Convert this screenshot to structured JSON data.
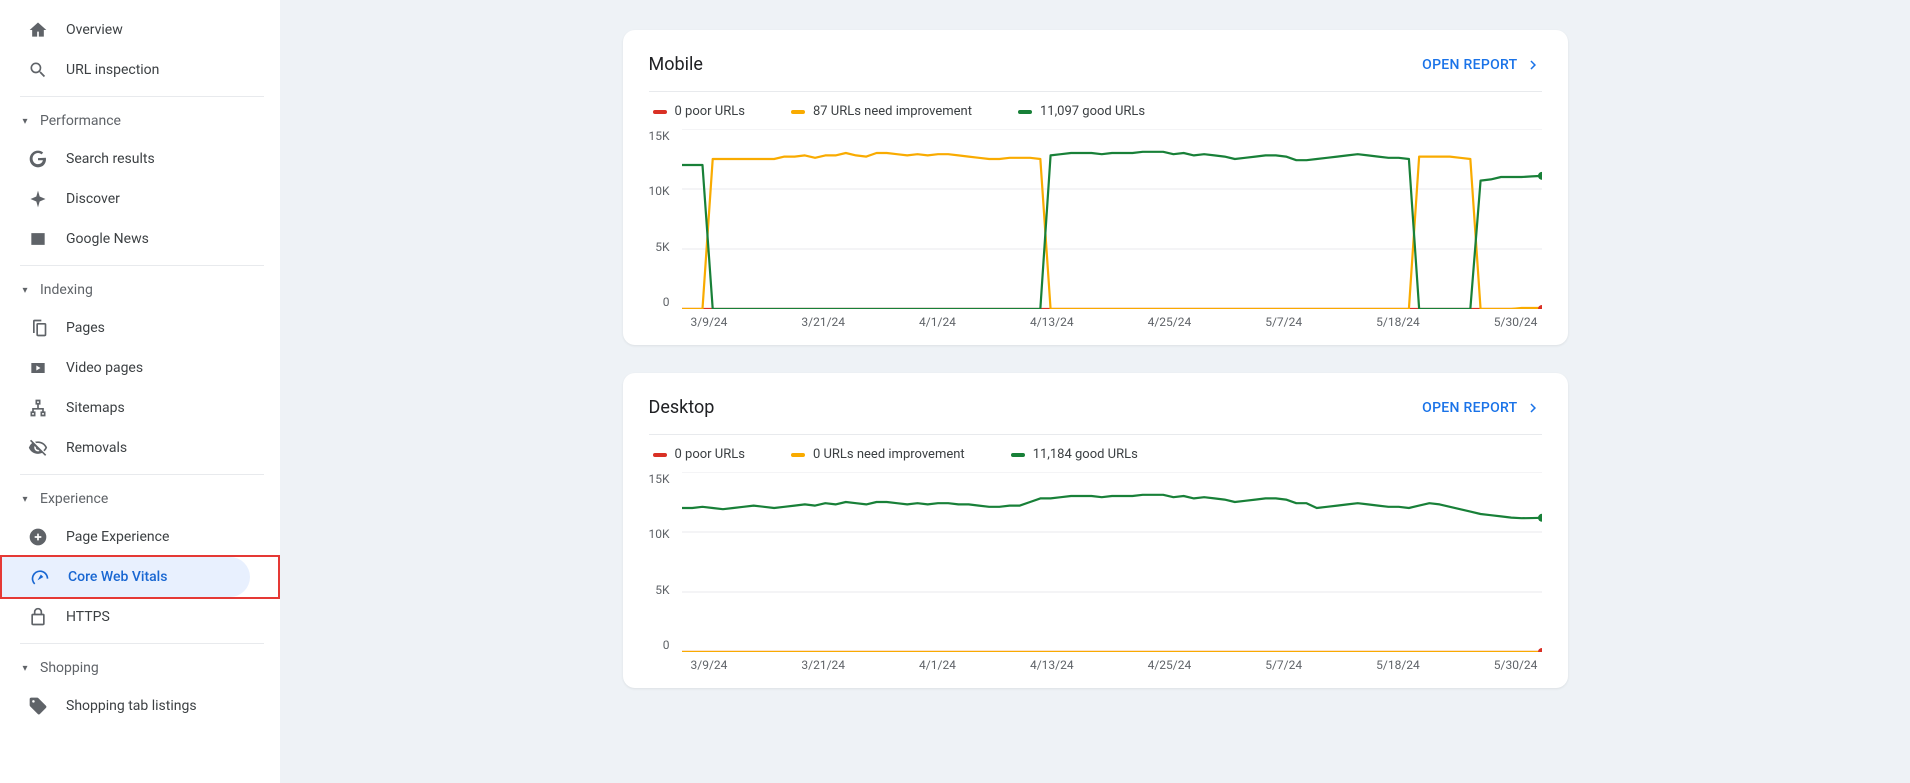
{
  "sidebar": {
    "overview": "Overview",
    "url_inspection": "URL inspection",
    "performance_hdr": "Performance",
    "search_results": "Search results",
    "discover": "Discover",
    "google_news": "Google News",
    "indexing_hdr": "Indexing",
    "pages": "Pages",
    "video_pages": "Video pages",
    "sitemaps": "Sitemaps",
    "removals": "Removals",
    "experience_hdr": "Experience",
    "page_experience": "Page Experience",
    "core_web_vitals": "Core Web Vitals",
    "https": "HTTPS",
    "shopping_hdr": "Shopping",
    "shopping_tab": "Shopping tab listings"
  },
  "common": {
    "open_report": "OPEN REPORT"
  },
  "mobile": {
    "title": "Mobile",
    "legend_poor": "0 poor URLs",
    "legend_need": "87 URLs need improvement",
    "legend_good": "11,097 good URLs"
  },
  "desktop": {
    "title": "Desktop",
    "legend_poor": "0 poor URLs",
    "legend_need": "0 URLs need improvement",
    "legend_good": "11,184 good URLs"
  },
  "axes": {
    "y": [
      "15K",
      "10K",
      "5K",
      "0"
    ],
    "x": [
      "3/9/24",
      "3/21/24",
      "4/1/24",
      "4/13/24",
      "4/25/24",
      "5/7/24",
      "5/18/24",
      "5/30/24"
    ]
  },
  "chart_data": [
    {
      "type": "line",
      "name": "mobile",
      "title": "Mobile",
      "ylim": [
        0,
        15000
      ],
      "yticks": [
        0,
        5000,
        10000,
        15000
      ],
      "xlabels": [
        "3/9/24",
        "3/21/24",
        "4/1/24",
        "4/13/24",
        "4/25/24",
        "5/7/24",
        "5/18/24",
        "5/30/24"
      ],
      "x": [
        0,
        1,
        2,
        3,
        4,
        5,
        6,
        7,
        8,
        9,
        10,
        11,
        12,
        13,
        14,
        15,
        16,
        17,
        18,
        19,
        20,
        21,
        22,
        23,
        24,
        25,
        26,
        27,
        28,
        29,
        30,
        31,
        32,
        33,
        34,
        35,
        36,
        37,
        38,
        39,
        40,
        41,
        42,
        43,
        44,
        45,
        46,
        47,
        48,
        49,
        50,
        51,
        52,
        53,
        54,
        55,
        56,
        57,
        58,
        59,
        60,
        61,
        62,
        63,
        64,
        65,
        66,
        67,
        68,
        69,
        70,
        71,
        72,
        73,
        74,
        75,
        76,
        77,
        78,
        79,
        80,
        81,
        82,
        83,
        84
      ],
      "series": [
        {
          "name": "poor",
          "color": "#d93025",
          "values": [
            0,
            0,
            0,
            0,
            0,
            0,
            0,
            0,
            0,
            0,
            0,
            0,
            0,
            0,
            0,
            0,
            0,
            0,
            0,
            0,
            0,
            0,
            0,
            0,
            0,
            0,
            0,
            0,
            0,
            0,
            0,
            0,
            0,
            0,
            0,
            0,
            0,
            0,
            0,
            0,
            0,
            0,
            0,
            0,
            0,
            0,
            0,
            0,
            0,
            0,
            0,
            0,
            0,
            0,
            0,
            0,
            0,
            0,
            0,
            0,
            0,
            0,
            0,
            0,
            0,
            0,
            0,
            0,
            0,
            0,
            0,
            0,
            0,
            0,
            0,
            0,
            0,
            0,
            0,
            0,
            0,
            0,
            0,
            0,
            0
          ]
        },
        {
          "name": "need_improvement",
          "color": "#f9ab00",
          "values": [
            0,
            0,
            0,
            12500,
            12500,
            12500,
            12500,
            12500,
            12500,
            12500,
            12700,
            12700,
            12800,
            12600,
            12800,
            12800,
            13000,
            12800,
            12700,
            13000,
            13000,
            12900,
            12800,
            12900,
            12800,
            12900,
            12900,
            12800,
            12700,
            12600,
            12500,
            12500,
            12600,
            12600,
            12600,
            12500,
            0,
            0,
            0,
            0,
            0,
            0,
            0,
            0,
            0,
            0,
            0,
            0,
            0,
            0,
            0,
            0,
            0,
            0,
            0,
            0,
            0,
            0,
            0,
            0,
            0,
            0,
            0,
            0,
            0,
            0,
            0,
            0,
            0,
            0,
            0,
            0,
            12700,
            12700,
            12700,
            12700,
            12600,
            12500,
            0,
            0,
            0,
            0,
            87,
            87,
            87
          ]
        },
        {
          "name": "good",
          "color": "#188038",
          "values": [
            12000,
            12000,
            12000,
            0,
            0,
            0,
            0,
            0,
            0,
            0,
            0,
            0,
            0,
            0,
            0,
            0,
            0,
            0,
            0,
            0,
            0,
            0,
            0,
            0,
            0,
            0,
            0,
            0,
            0,
            0,
            0,
            0,
            0,
            0,
            0,
            0,
            12800,
            12900,
            13000,
            13000,
            13000,
            12900,
            13000,
            13000,
            13000,
            13100,
            13100,
            13100,
            12900,
            13000,
            12800,
            12900,
            12800,
            12700,
            12500,
            12600,
            12700,
            12800,
            12800,
            12700,
            12400,
            12400,
            12500,
            12600,
            12700,
            12800,
            12900,
            12800,
            12700,
            12600,
            12600,
            12500,
            0,
            0,
            0,
            0,
            0,
            0,
            10700,
            10800,
            11000,
            11000,
            11000,
            11050,
            11097
          ]
        }
      ]
    },
    {
      "type": "line",
      "name": "desktop",
      "title": "Desktop",
      "ylim": [
        0,
        15000
      ],
      "yticks": [
        0,
        5000,
        10000,
        15000
      ],
      "xlabels": [
        "3/9/24",
        "3/21/24",
        "4/1/24",
        "4/13/24",
        "4/25/24",
        "5/7/24",
        "5/18/24",
        "5/30/24"
      ],
      "x": [
        0,
        1,
        2,
        3,
        4,
        5,
        6,
        7,
        8,
        9,
        10,
        11,
        12,
        13,
        14,
        15,
        16,
        17,
        18,
        19,
        20,
        21,
        22,
        23,
        24,
        25,
        26,
        27,
        28,
        29,
        30,
        31,
        32,
        33,
        34,
        35,
        36,
        37,
        38,
        39,
        40,
        41,
        42,
        43,
        44,
        45,
        46,
        47,
        48,
        49,
        50,
        51,
        52,
        53,
        54,
        55,
        56,
        57,
        58,
        59,
        60,
        61,
        62,
        63,
        64,
        65,
        66,
        67,
        68,
        69,
        70,
        71,
        72,
        73,
        74,
        75,
        76,
        77,
        78,
        79,
        80,
        81,
        82,
        83,
        84
      ],
      "series": [
        {
          "name": "poor",
          "color": "#d93025",
          "values": [
            0,
            0,
            0,
            0,
            0,
            0,
            0,
            0,
            0,
            0,
            0,
            0,
            0,
            0,
            0,
            0,
            0,
            0,
            0,
            0,
            0,
            0,
            0,
            0,
            0,
            0,
            0,
            0,
            0,
            0,
            0,
            0,
            0,
            0,
            0,
            0,
            0,
            0,
            0,
            0,
            0,
            0,
            0,
            0,
            0,
            0,
            0,
            0,
            0,
            0,
            0,
            0,
            0,
            0,
            0,
            0,
            0,
            0,
            0,
            0,
            0,
            0,
            0,
            0,
            0,
            0,
            0,
            0,
            0,
            0,
            0,
            0,
            0,
            0,
            0,
            0,
            0,
            0,
            0,
            0,
            0,
            0,
            0,
            0,
            0
          ]
        },
        {
          "name": "need_improvement",
          "color": "#f9ab00",
          "values": [
            0,
            0,
            0,
            0,
            0,
            0,
            0,
            0,
            0,
            0,
            0,
            0,
            0,
            0,
            0,
            0,
            0,
            0,
            0,
            0,
            0,
            0,
            0,
            0,
            0,
            0,
            0,
            0,
            0,
            0,
            0,
            0,
            0,
            0,
            0,
            0,
            0,
            0,
            0,
            0,
            0,
            0,
            0,
            0,
            0,
            0,
            0,
            0,
            0,
            0,
            0,
            0,
            0,
            0,
            0,
            0,
            0,
            0,
            0,
            0,
            0,
            0,
            0,
            0,
            0,
            0,
            0,
            0,
            0,
            0,
            0,
            0,
            0,
            0,
            0,
            0,
            0,
            0,
            0,
            0,
            0,
            0,
            0,
            0,
            0
          ]
        },
        {
          "name": "good",
          "color": "#188038",
          "values": [
            12000,
            12000,
            12100,
            12000,
            11900,
            12000,
            12100,
            12200,
            12100,
            12000,
            12100,
            12200,
            12300,
            12200,
            12400,
            12300,
            12500,
            12400,
            12300,
            12500,
            12500,
            12400,
            12300,
            12400,
            12300,
            12400,
            12400,
            12300,
            12300,
            12200,
            12100,
            12100,
            12200,
            12200,
            12500,
            12800,
            12800,
            12900,
            13000,
            13000,
            13000,
            12900,
            13000,
            13000,
            13000,
            13100,
            13100,
            13100,
            12900,
            13000,
            12800,
            12900,
            12800,
            12700,
            12500,
            12600,
            12700,
            12800,
            12800,
            12700,
            12400,
            12400,
            12000,
            12100,
            12200,
            12300,
            12400,
            12300,
            12200,
            12100,
            12100,
            12000,
            12200,
            12400,
            12300,
            12100,
            11900,
            11700,
            11500,
            11400,
            11300,
            11200,
            11150,
            11160,
            11184
          ]
        }
      ]
    }
  ]
}
